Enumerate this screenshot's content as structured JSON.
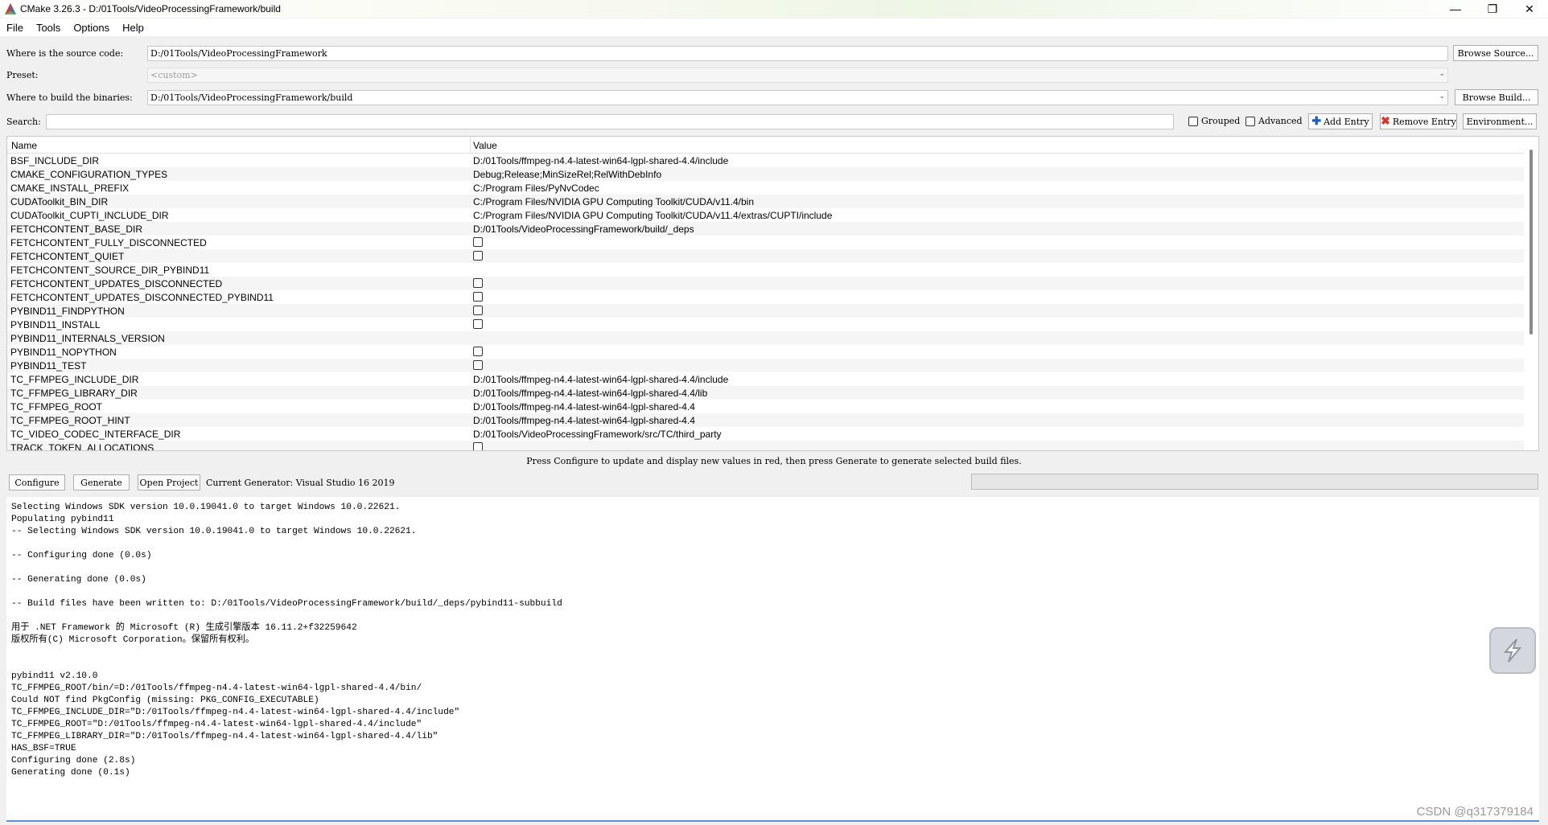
{
  "window": {
    "title": "CMake 3.26.3 - D:/01Tools/VideoProcessingFramework/build",
    "minimize_icon": "minimize-icon",
    "maximize_icon": "restore-icon",
    "close_icon": "close-icon"
  },
  "menu": [
    "File",
    "Tools",
    "Options",
    "Help"
  ],
  "source": {
    "label": "Where is the source code:",
    "value": "D:/01Tools/VideoProcessingFramework",
    "button": "Browse Source..."
  },
  "preset": {
    "label": "Preset:",
    "value": "<custom>"
  },
  "build": {
    "label": "Where to build the binaries:",
    "value": "D:/01Tools/VideoProcessingFramework/build",
    "button": "Browse Build..."
  },
  "search": {
    "label": "Search:",
    "value": "",
    "grouped": "Grouped",
    "advanced": "Advanced",
    "add_entry": "Add Entry",
    "remove_entry": "Remove Entry",
    "environment": "Environment..."
  },
  "table": {
    "col_name": "Name",
    "col_value": "Value",
    "rows": [
      {
        "name": "BSF_INCLUDE_DIR",
        "value": "D:/01Tools/ffmpeg-n4.4-latest-win64-lgpl-shared-4.4/include",
        "type": "text"
      },
      {
        "name": "CMAKE_CONFIGURATION_TYPES",
        "value": "Debug;Release;MinSizeRel;RelWithDebInfo",
        "type": "text"
      },
      {
        "name": "CMAKE_INSTALL_PREFIX",
        "value": "C:/Program Files/PyNvCodec",
        "type": "text"
      },
      {
        "name": "CUDAToolkit_BIN_DIR",
        "value": "C:/Program Files/NVIDIA GPU Computing Toolkit/CUDA/v11.4/bin",
        "type": "text"
      },
      {
        "name": "CUDAToolkit_CUPTI_INCLUDE_DIR",
        "value": "C:/Program Files/NVIDIA GPU Computing Toolkit/CUDA/v11.4/extras/CUPTI/include",
        "type": "text"
      },
      {
        "name": "FETCHCONTENT_BASE_DIR",
        "value": "D:/01Tools/VideoProcessingFramework/build/_deps",
        "type": "text"
      },
      {
        "name": "FETCHCONTENT_FULLY_DISCONNECTED",
        "value": "",
        "type": "bool"
      },
      {
        "name": "FETCHCONTENT_QUIET",
        "value": "",
        "type": "bool"
      },
      {
        "name": "FETCHCONTENT_SOURCE_DIR_PYBIND11",
        "value": "",
        "type": "text"
      },
      {
        "name": "FETCHCONTENT_UPDATES_DISCONNECTED",
        "value": "",
        "type": "bool"
      },
      {
        "name": "FETCHCONTENT_UPDATES_DISCONNECTED_PYBIND11",
        "value": "",
        "type": "bool"
      },
      {
        "name": "PYBIND11_FINDPYTHON",
        "value": "",
        "type": "bool"
      },
      {
        "name": "PYBIND11_INSTALL",
        "value": "",
        "type": "bool"
      },
      {
        "name": "PYBIND11_INTERNALS_VERSION",
        "value": "",
        "type": "text"
      },
      {
        "name": "PYBIND11_NOPYTHON",
        "value": "",
        "type": "bool"
      },
      {
        "name": "PYBIND11_TEST",
        "value": "",
        "type": "bool"
      },
      {
        "name": "TC_FFMPEG_INCLUDE_DIR",
        "value": "D:/01Tools/ffmpeg-n4.4-latest-win64-lgpl-shared-4.4/include",
        "type": "text"
      },
      {
        "name": "TC_FFMPEG_LIBRARY_DIR",
        "value": "D:/01Tools/ffmpeg-n4.4-latest-win64-lgpl-shared-4.4/lib",
        "type": "text"
      },
      {
        "name": "TC_FFMPEG_ROOT",
        "value": "D:/01Tools/ffmpeg-n4.4-latest-win64-lgpl-shared-4.4",
        "type": "text"
      },
      {
        "name": "TC_FFMPEG_ROOT_HINT",
        "value": "D:/01Tools/ffmpeg-n4.4-latest-win64-lgpl-shared-4.4",
        "type": "text"
      },
      {
        "name": "TC_VIDEO_CODEC_INTERFACE_DIR",
        "value": "D:/01Tools/VideoProcessingFramework/src/TC/third_party",
        "type": "text"
      },
      {
        "name": "TRACK_TOKEN_ALLOCATIONS",
        "value": "",
        "type": "bool"
      }
    ]
  },
  "hint": "Press Configure to update and display new values in red, then press Generate to generate selected build files.",
  "actions": {
    "configure": "Configure",
    "generate": "Generate",
    "open_project": "Open Project",
    "generator": "Current Generator: Visual Studio 16 2019"
  },
  "log": [
    "Selecting Windows SDK version 10.0.19041.0 to target Windows 10.0.22621.",
    "Populating pybind11",
    "-- Selecting Windows SDK version 10.0.19041.0 to target Windows 10.0.22621.",
    "",
    "-- Configuring done (0.0s)",
    "",
    "-- Generating done (0.0s)",
    "",
    "-- Build files have been written to: D:/01Tools/VideoProcessingFramework/build/_deps/pybind11-subbuild",
    "",
    "用于 .NET Framework 的 Microsoft (R) 生成引擎版本 16.11.2+f32259642",
    "版权所有(C) Microsoft Corporation。保留所有权利。",
    "",
    "",
    "pybind11 v2.10.0",
    "TC_FFMPEG_ROOT/bin/=D:/01Tools/ffmpeg-n4.4-latest-win64-lgpl-shared-4.4/bin/",
    "Could NOT find PkgConfig (missing: PKG_CONFIG_EXECUTABLE)",
    "TC_FFMPEG_INCLUDE_DIR=\"D:/01Tools/ffmpeg-n4.4-latest-win64-lgpl-shared-4.4/include\"",
    "TC_FFMPEG_ROOT=\"D:/01Tools/ffmpeg-n4.4-latest-win64-lgpl-shared-4.4/include\"",
    "TC_FFMPEG_LIBRARY_DIR=\"D:/01Tools/ffmpeg-n4.4-latest-win64-lgpl-shared-4.4/lib\"",
    "HAS_BSF=TRUE",
    "Configuring done (2.8s)",
    "Generating done (0.1s)"
  ],
  "watermark": "CSDN @q317379184",
  "colors": {
    "app_red": "#d23a2c",
    "add_blue": "#1b5fc4",
    "remove_red": "#e0302a"
  }
}
